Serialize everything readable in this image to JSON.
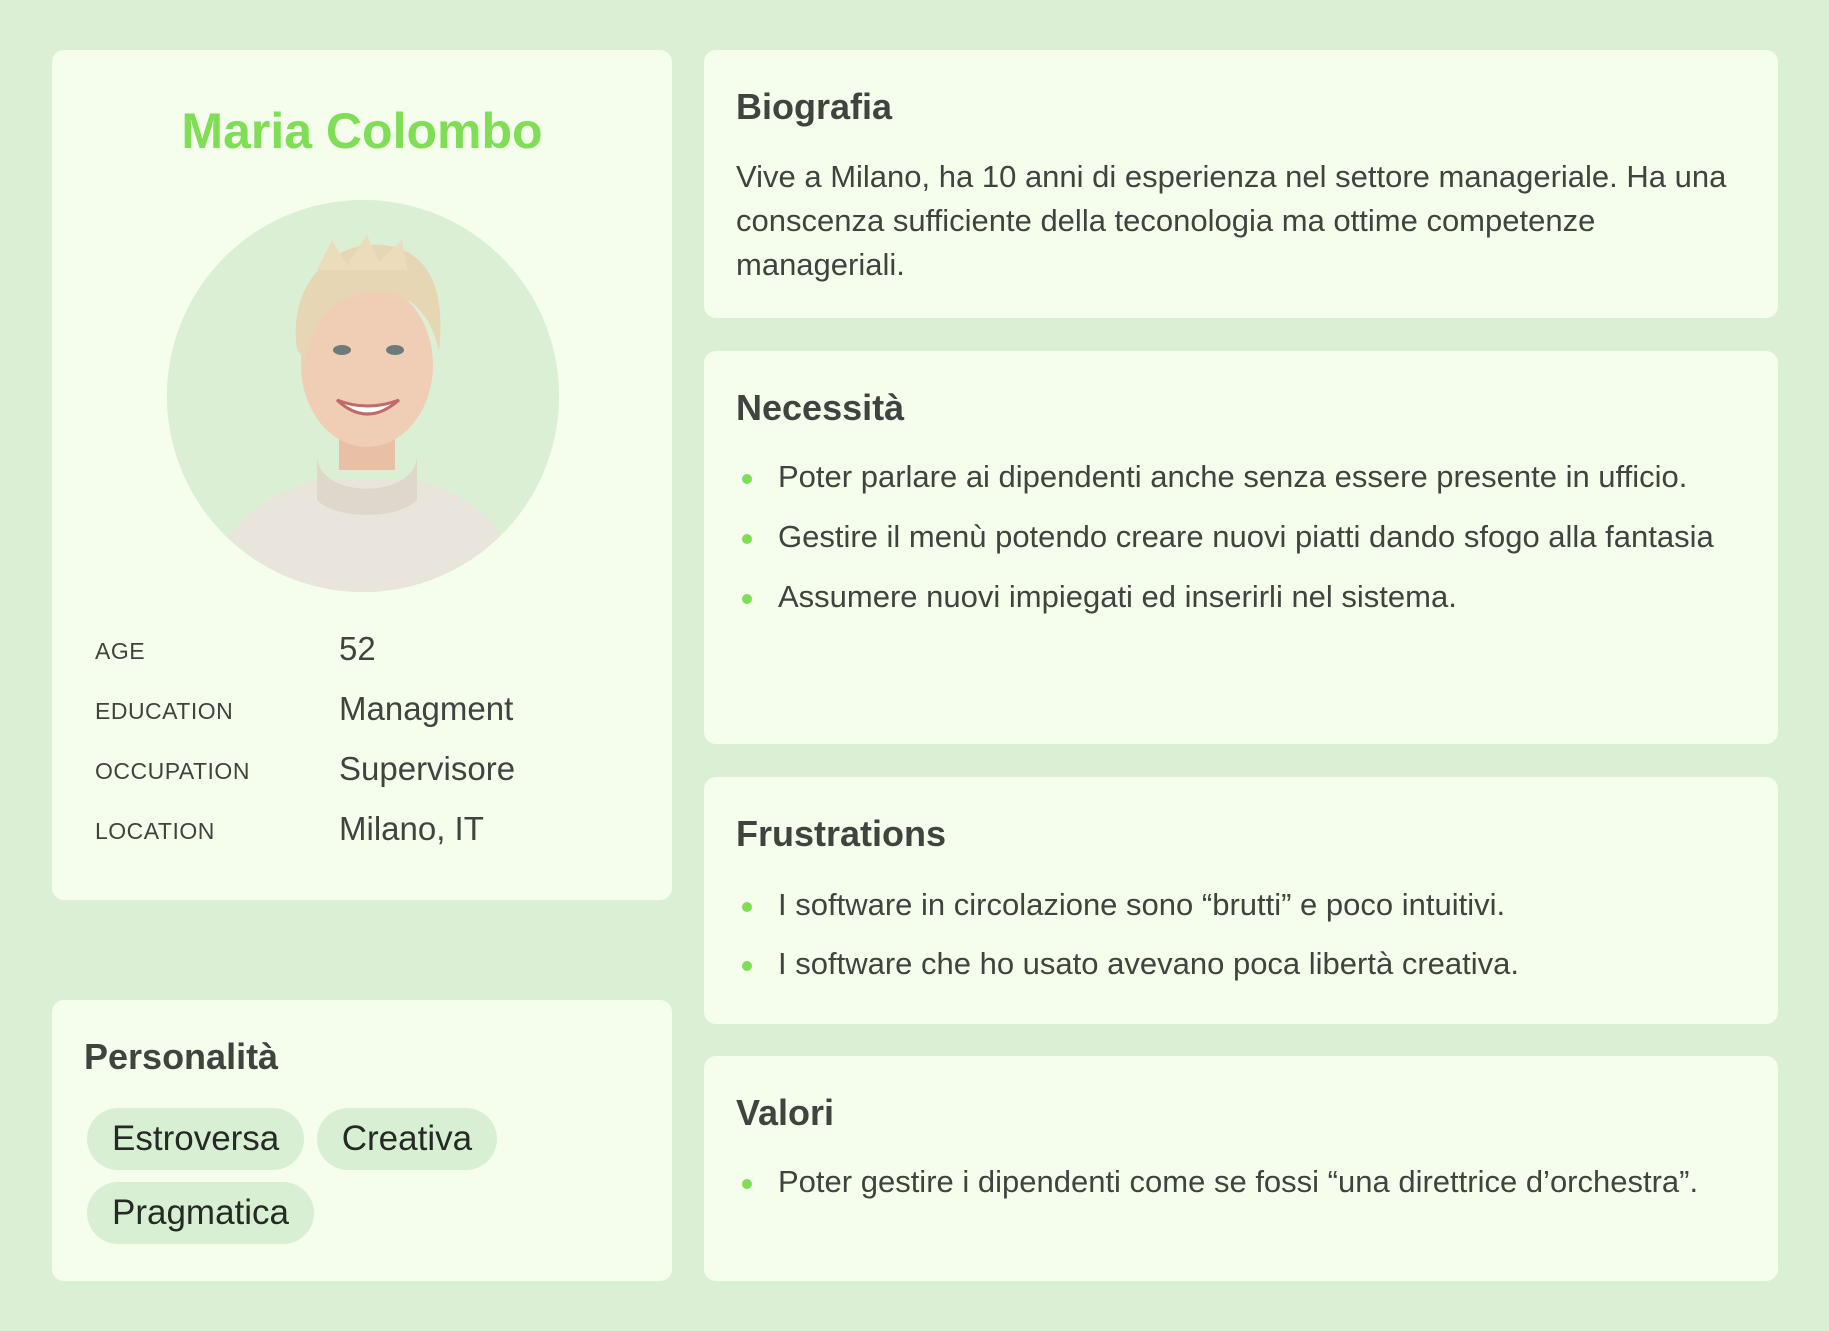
{
  "profile": {
    "name": "Maria Colombo",
    "info": [
      {
        "key": "AGE",
        "value": "52"
      },
      {
        "key": "EDUCATION",
        "value": "Managment"
      },
      {
        "key": "OCCUPATION",
        "value": "Supervisore"
      },
      {
        "key": "LOCATION",
        "value": "Milano, IT"
      }
    ]
  },
  "personality": {
    "title": "Personalità",
    "traits": [
      "Estroversa",
      "Creativa",
      "Pragmatica"
    ]
  },
  "bio": {
    "title": "Biografia",
    "text": "Vive a Milano, ha 10 anni di esperienza nel settore manageriale. Ha una conscenza sufficiente della teconologia ma ottime competenze manageriali."
  },
  "needs": {
    "title": "Necessità",
    "items": [
      "Poter parlare ai dipendenti  anche senza essere presente in ufficio.",
      "Gestire il menù potendo creare nuovi piatti dando sfogo alla fantasia",
      "Assumere nuovi impiegati ed inserirli nel sistema."
    ]
  },
  "frustrations": {
    "title": "Frustrations",
    "items": [
      "I software in circolazione sono “brutti” e poco intuitivi.",
      "I software che ho usato avevano poca libertà creativa."
    ]
  },
  "values": {
    "title": "Valori",
    "items": [
      "Poter gestire i dipendenti come se fossi “una direttrice d’orchestra”."
    ]
  },
  "colors": {
    "background": "#dbefd5",
    "card": "#f5fdec",
    "accent": "#7fde55",
    "chip": "#d9efd3",
    "text": "#3f443f"
  }
}
